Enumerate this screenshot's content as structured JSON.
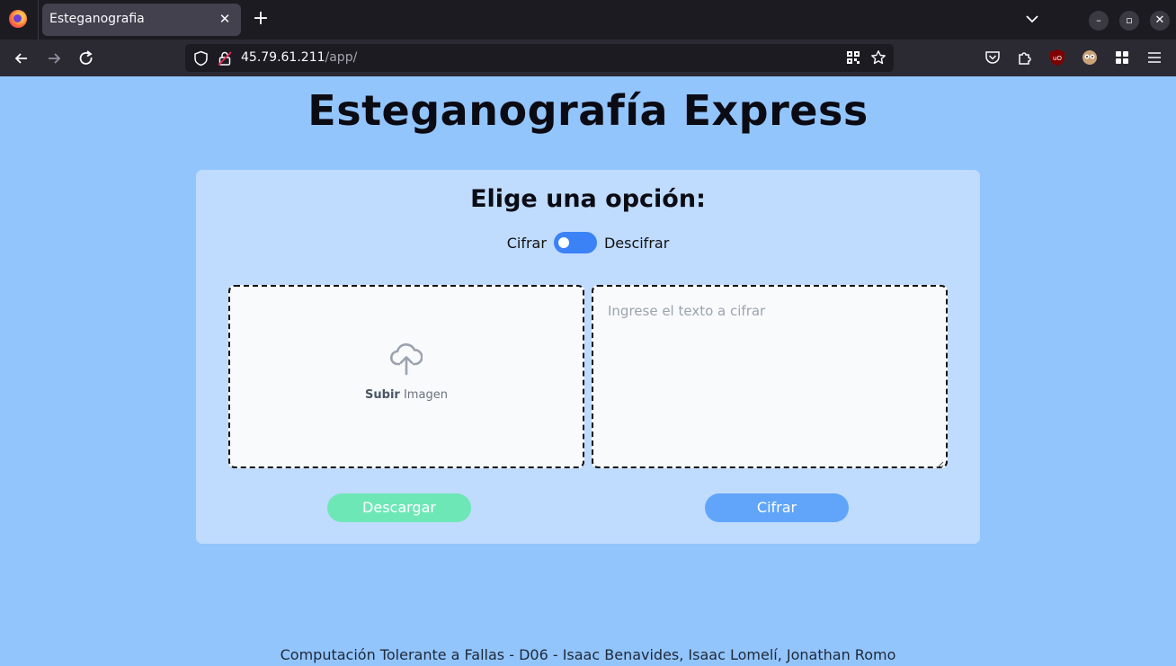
{
  "browser": {
    "tab": {
      "title": "Esteganografia",
      "close": "✕"
    },
    "new_tab": "+",
    "url": {
      "host": "45.79.61.211",
      "path": "/app/"
    }
  },
  "page": {
    "title": "Esteganografía Express",
    "card": {
      "heading": "Elige una opción:",
      "mode_left": "Cifrar",
      "mode_right": "Descifrar",
      "upload_bold": "Subir",
      "upload_text": " Imagen",
      "textarea_placeholder": "Ingrese el texto a cifrar",
      "download_label": "Descargar",
      "submit_label": "Cifrar"
    },
    "footer": "Computación Tolerante a Fallas - D06 - Isaac Benavides, Isaac Lomelí, Jonathan Romo"
  },
  "colors": {
    "page_bg": "#93c5fd",
    "card_bg": "#bfdbfe",
    "toggle": "#3b82f6",
    "download_button": "#6ee7b7",
    "submit_button": "#60a5fa"
  }
}
